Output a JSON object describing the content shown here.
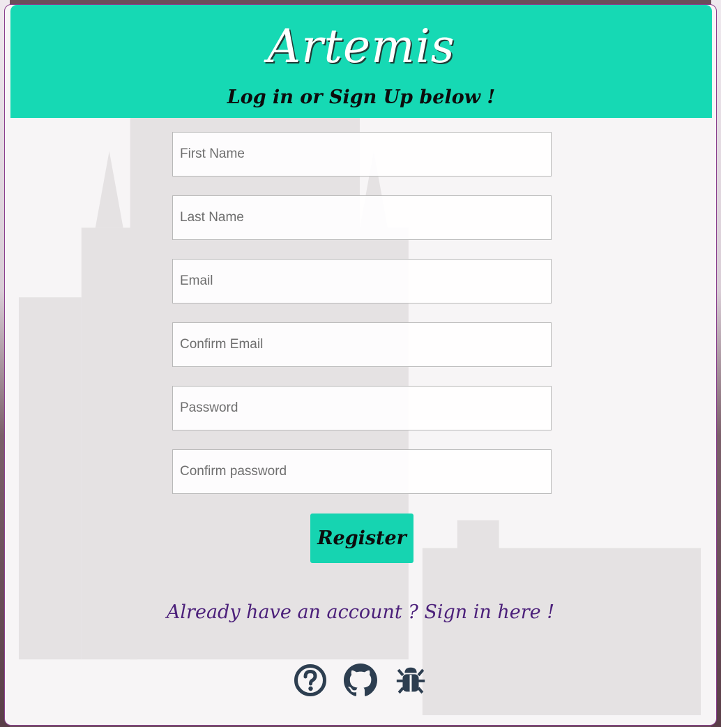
{
  "header": {
    "title": "Artemis",
    "subtitle": "Log in or Sign Up below !"
  },
  "form": {
    "first_name_placeholder": "First Name",
    "last_name_placeholder": "Last Name",
    "email_placeholder": "Email",
    "confirm_email_placeholder": "Confirm Email",
    "password_placeholder": "Password",
    "confirm_password_placeholder": "Confirm password",
    "register_label": "Register"
  },
  "signin_link": "Already have an account ? Sign in here !",
  "footer": {
    "icons": [
      "help-icon",
      "github-icon",
      "bug-icon"
    ],
    "icon_color": "#2d3e50"
  },
  "colors": {
    "accent": "#16d9b4",
    "link": "#4b1f7a",
    "card_border": "#8a3f8d"
  }
}
